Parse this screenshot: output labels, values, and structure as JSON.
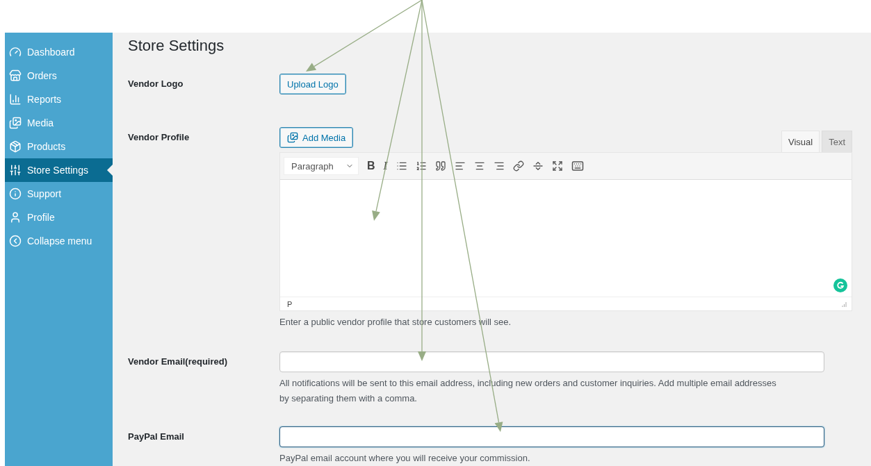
{
  "sidebar": {
    "items": [
      {
        "label": "Dashboard",
        "selected": false
      },
      {
        "label": "Orders",
        "selected": false
      },
      {
        "label": "Reports",
        "selected": false
      },
      {
        "label": "Media",
        "selected": false
      },
      {
        "label": "Products",
        "selected": false
      },
      {
        "label": "Store Settings",
        "selected": true
      },
      {
        "label": "Support",
        "selected": false
      },
      {
        "label": "Profile",
        "selected": false
      },
      {
        "label": "Collapse menu",
        "selected": false
      }
    ]
  },
  "page_title": "Store Settings",
  "fields": [
    {
      "kind": "upload",
      "label": "Vendor Logo",
      "button": "Upload Logo"
    },
    {
      "kind": "editor",
      "label": "Vendor Profile",
      "button": "Add Media",
      "tabs": [
        {
          "label": "Visual",
          "selected": true
        },
        {
          "label": "Text",
          "selected": false
        }
      ],
      "format": "Paragraph",
      "bold": "B",
      "italic": "I",
      "path": "P",
      "help": "Enter a public vendor profile that store customers will see."
    },
    {
      "kind": "text",
      "label": "Vendor Email(required)",
      "focused": false,
      "help": "All notifications will be sent to this email address, including new orders and customer inquiries. Add multiple email addresses by separating them with a comma."
    },
    {
      "kind": "text",
      "label": "PayPal Email",
      "focused": true,
      "help": "PayPal email account where you will receive your commission."
    }
  ]
}
